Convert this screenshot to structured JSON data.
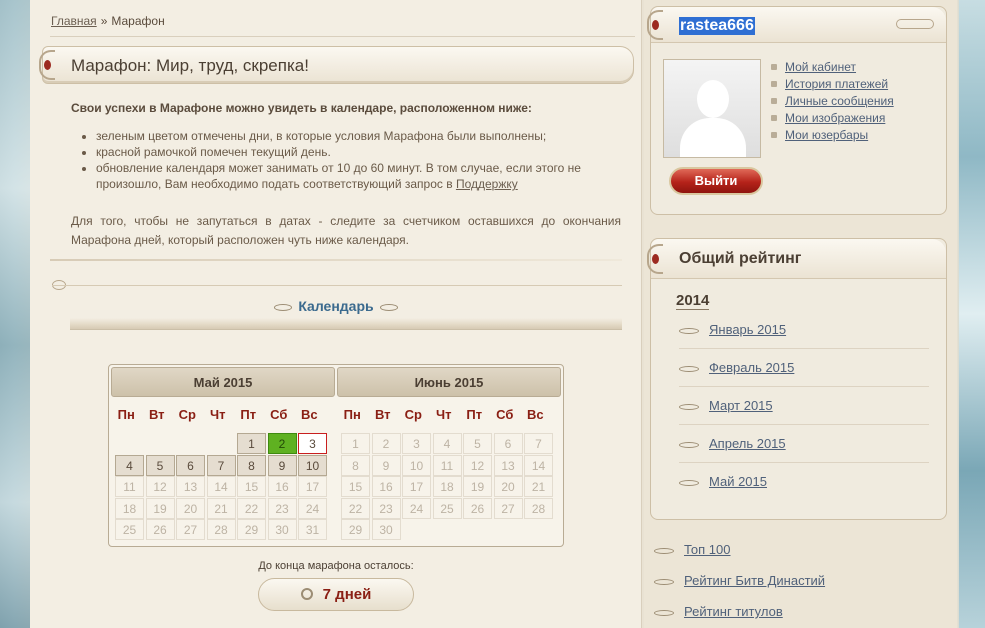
{
  "breadcrumb": {
    "home": "Главная",
    "separator": "»",
    "current": "Марафон"
  },
  "page_title": "Марафон: Мир, труд, скрепка!",
  "intro": "Свои успехи в Марафоне можно увидеть в календаре, расположенном ниже:",
  "bullets": {
    "b1": "зеленым цветом отмечены дни, в которые условия Марафона были выполнены;",
    "b2": "красной рамочкой помечен текущий день.",
    "b3": "обновление календаря может занимать от 10 до 60 минут. В том случае, если этого не произошло, Вам необходимо подать соответствующий запрос в ",
    "b3_link": "Поддержку"
  },
  "paragraph": "Для того, чтобы не запутаться в датах - следите за счетчиком оставшихся до окончания Марафона дней, который расположен чуть ниже календаря.",
  "calendar_heading": "Календарь",
  "calendar": {
    "weekdays": [
      "Пн",
      "Вт",
      "Ср",
      "Чт",
      "Пт",
      "Сб",
      "Вс"
    ],
    "months": [
      {
        "title": "Май 2015",
        "first_weekday": 4,
        "days": 31,
        "past_through": 10,
        "done": [
          2
        ],
        "today": 3
      },
      {
        "title": "Июнь 2015",
        "first_weekday": 0,
        "days": 30,
        "past_through": 0,
        "done": [],
        "today": null
      }
    ]
  },
  "countdown": {
    "label": "До конца марафона осталось:",
    "value": "7 дней"
  },
  "user": {
    "name": "rastea666",
    "menu": [
      "Мой кабинет",
      "История платежей",
      "Личные сообщения",
      "Мои изображения",
      "Мои юзербары"
    ],
    "logout": "Выйти"
  },
  "rating": {
    "title": "Общий рейтинг",
    "year": "2014",
    "months": [
      "Январь 2015",
      "Февраль 2015",
      "Март 2015",
      "Апрель 2015",
      "Май 2015"
    ]
  },
  "bottom_links": [
    "Топ 100",
    "Рейтинг Битв Династий",
    "Рейтинг титулов"
  ],
  "colors": {
    "done": "#5fb121",
    "today_border": "#c81e1e",
    "weekday": "#8a1f14",
    "heading_blue": "#3b6a8e",
    "logout_red": "#b5231a"
  }
}
